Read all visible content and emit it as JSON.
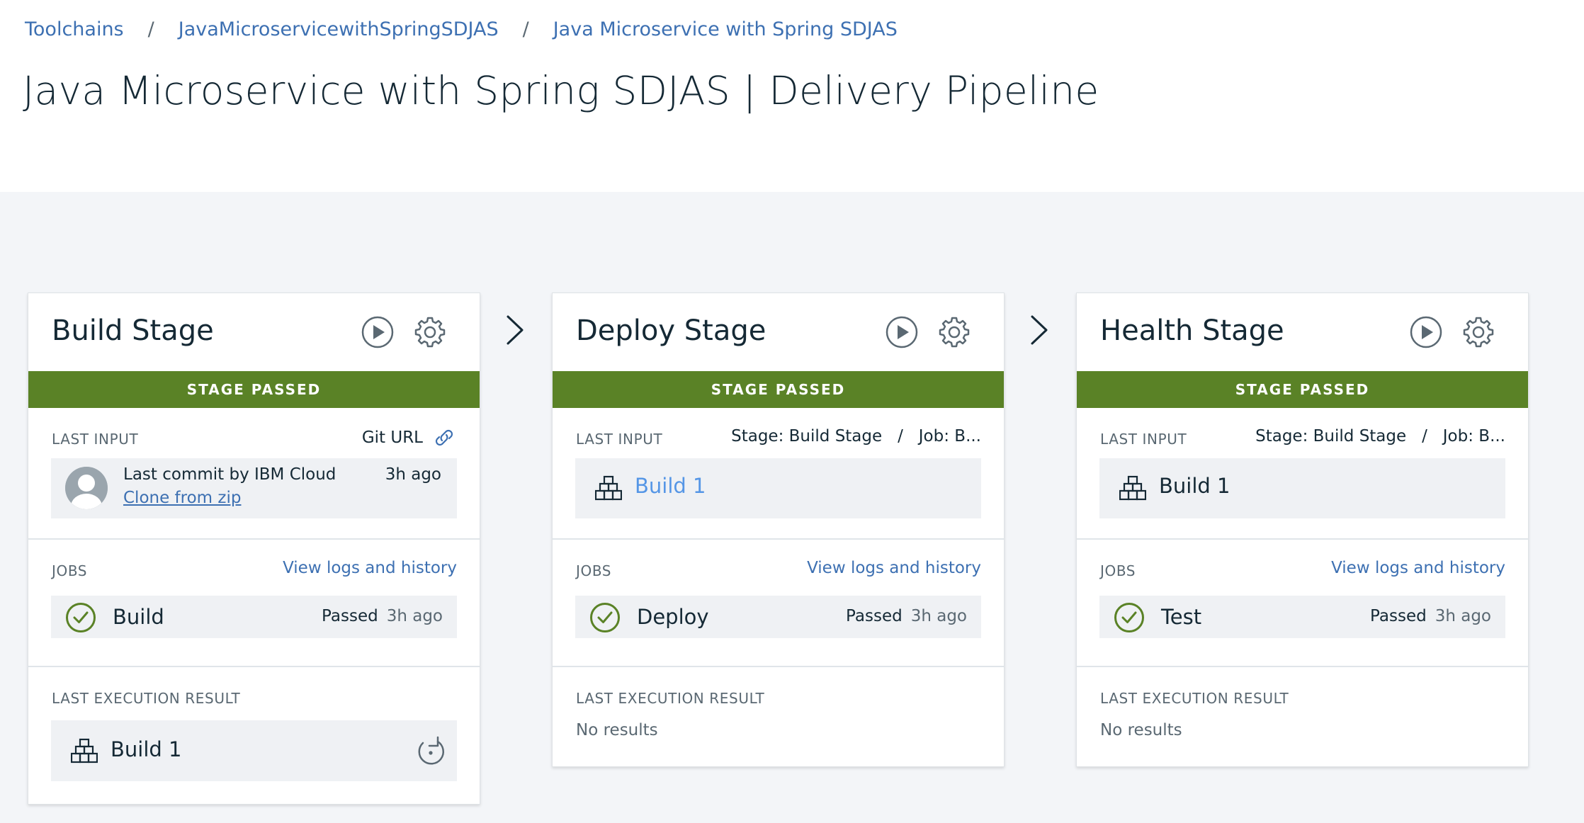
{
  "breadcrumb": {
    "items": [
      "Toolchains",
      "JavaMicroservicewithSpringSDJAS",
      "Java Microservice with Spring SDJAS"
    ],
    "separator": "/"
  },
  "page_title": "Java Microservice with Spring SDJAS | Delivery Pipeline",
  "colors": {
    "accent": "#3d70b2",
    "status_passed": "#5a8226",
    "check": "#5a8226"
  },
  "stages": [
    {
      "title": "Build Stage",
      "status": "STAGE PASSED",
      "last_input_label": "LAST INPUT",
      "last_input_source": "Git URL",
      "commit_text": "Last commit by IBM Cloud",
      "commit_link": "Clone from zip",
      "commit_time": "3h ago",
      "jobs_label": "JOBS",
      "jobs_link": "View logs and history",
      "job_name": "Build",
      "job_status": "Passed",
      "job_time": "3h ago",
      "result_label": "LAST EXECUTION RESULT",
      "result_value": "Build 1"
    },
    {
      "title": "Deploy Stage",
      "status": "STAGE PASSED",
      "last_input_label": "LAST INPUT",
      "last_input_source": "Stage: Build Stage   /   Job: B...",
      "input_build": "Build 1",
      "jobs_label": "JOBS",
      "jobs_link": "View logs and history",
      "job_name": "Deploy",
      "job_status": "Passed",
      "job_time": "3h ago",
      "result_label": "LAST EXECUTION RESULT",
      "result_value": "No results"
    },
    {
      "title": "Health Stage",
      "status": "STAGE PASSED",
      "last_input_label": "LAST INPUT",
      "last_input_source": "Stage: Build Stage   /   Job: B...",
      "input_build": "Build 1",
      "jobs_label": "JOBS",
      "jobs_link": "View logs and history",
      "job_name": "Test",
      "job_status": "Passed",
      "job_time": "3h ago",
      "result_label": "LAST EXECUTION RESULT",
      "result_value": "No results"
    }
  ]
}
